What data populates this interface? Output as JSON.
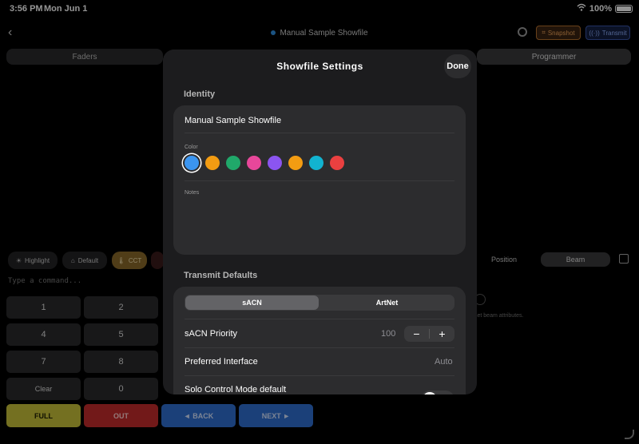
{
  "status": {
    "time": "3:56 PM",
    "date": "Mon Jun 1",
    "battery": "100%"
  },
  "nav": {
    "title": "Manual Sample Showfile",
    "snapshot": "Snapshot",
    "transmit": "Transmit"
  },
  "top_tabs": [
    "Faders",
    "Programmer"
  ],
  "mid_buttons": [
    "Highlight",
    "Default",
    "CCT"
  ],
  "right_tabs": [
    "Position",
    "Beam"
  ],
  "command": {
    "placeholder": "Type a command..."
  },
  "keypad": [
    "1",
    "2",
    "4",
    "5",
    "7",
    "8",
    "Clear",
    "0"
  ],
  "bottom_keys": [
    "FULL",
    "OUT",
    "◄ BACK",
    "NEXT ►"
  ],
  "beam_hint": "set beam attributes.",
  "modal": {
    "title": "Showfile Settings",
    "done": "Done",
    "identity_label": "Identity",
    "name": "Manual Sample Showfile",
    "color_label": "Color",
    "notes_label": "Notes",
    "colors": [
      "#3b95f0",
      "#f39c12",
      "#20a86a",
      "#e8479a",
      "#8b55f0",
      "#f39c12",
      "#12b3d0",
      "#ea4040"
    ],
    "transmit_label": "Transmit Defaults",
    "protocols": [
      "sACN",
      "ArtNet"
    ],
    "protocol_selected": "sACN",
    "priority_label": "sACN Priority",
    "priority_value": "100",
    "minus": "−",
    "plus": "+",
    "interface_label": "Preferred Interface",
    "interface_value": "Auto",
    "solo_label": "Solo Control Mode default"
  }
}
